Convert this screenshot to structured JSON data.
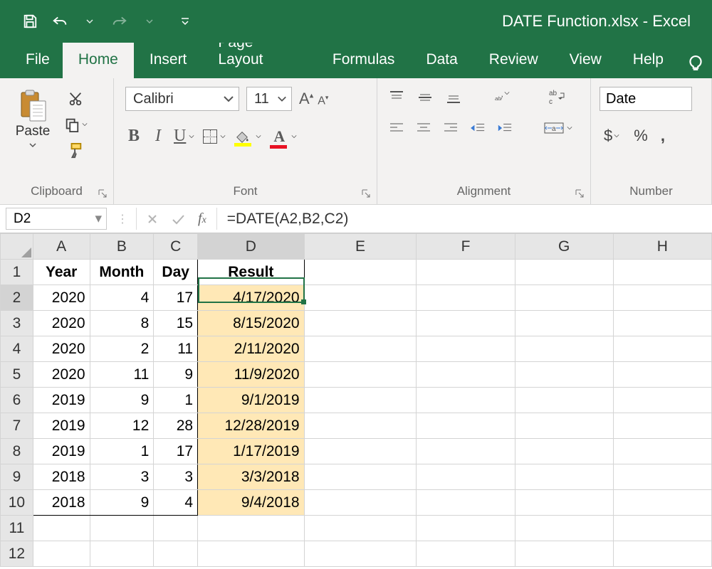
{
  "title": {
    "filename": "DATE Function.xlsx",
    "sep": "  -  ",
    "app": "Excel"
  },
  "tabs": {
    "file": "File",
    "home": "Home",
    "insert": "Insert",
    "page": "Page Layout",
    "formulas": "Formulas",
    "data": "Data",
    "review": "Review",
    "view": "View",
    "help": "Help"
  },
  "ribbon": {
    "clipboard": {
      "paste": "Paste",
      "label": "Clipboard"
    },
    "font": {
      "name": "Calibri",
      "size": "11",
      "label": "Font"
    },
    "alignment": {
      "label": "Alignment"
    },
    "number": {
      "format": "Date",
      "label": "Number",
      "dollar": "$",
      "percent": "%",
      "comma": ","
    }
  },
  "fx": {
    "namebox": "D2",
    "formula": "=DATE(A2,B2,C2)"
  },
  "columns": [
    "A",
    "B",
    "C",
    "D",
    "E",
    "F",
    "G",
    "H"
  ],
  "headers": {
    "A": "Year",
    "B": "Month",
    "C": "Day",
    "D": "Result"
  },
  "rows": [
    {
      "n": "1"
    },
    {
      "n": "2",
      "A": "2020",
      "B": "4",
      "C": "17",
      "D": "4/17/2020"
    },
    {
      "n": "3",
      "A": "2020",
      "B": "8",
      "C": "15",
      "D": "8/15/2020"
    },
    {
      "n": "4",
      "A": "2020",
      "B": "2",
      "C": "11",
      "D": "2/11/2020"
    },
    {
      "n": "5",
      "A": "2020",
      "B": "11",
      "C": "9",
      "D": "11/9/2020"
    },
    {
      "n": "6",
      "A": "2019",
      "B": "9",
      "C": "1",
      "D": "9/1/2019"
    },
    {
      "n": "7",
      "A": "2019",
      "B": "12",
      "C": "28",
      "D": "12/28/2019"
    },
    {
      "n": "8",
      "A": "2019",
      "B": "1",
      "C": "17",
      "D": "1/17/2019"
    },
    {
      "n": "9",
      "A": "2018",
      "B": "3",
      "C": "3",
      "D": "3/3/2018"
    },
    {
      "n": "10",
      "A": "2018",
      "B": "9",
      "C": "4",
      "D": "9/4/2018"
    },
    {
      "n": "11"
    },
    {
      "n": "12"
    }
  ]
}
